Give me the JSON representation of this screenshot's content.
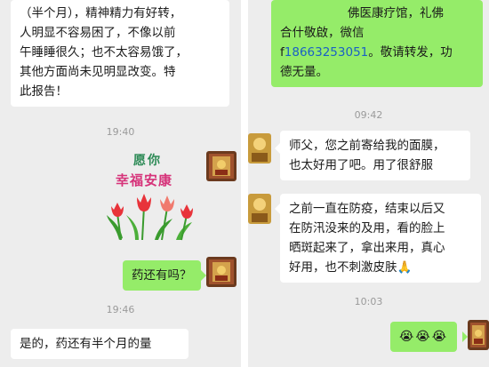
{
  "left": {
    "msg1_lines": [
      "（半个月），精神精力有好转，",
      "人明显不容易困了，不像以前",
      "午睡睡很久；也不太容易饿了，",
      "其他方面尚未见明显改变。特",
      "此报告！"
    ],
    "time1": "19:40",
    "sticker": {
      "line1": "愿你",
      "line2": "幸福安康",
      "colors": {
        "tulip_red": "#e8333a",
        "tulip_pink": "#f07a6e",
        "leaf_green": "#3a9b2e",
        "text_green": "#2e8b57",
        "text_pink": "#d6337a"
      }
    },
    "msg2": "药还有吗？",
    "time2": "19:46",
    "msg3": "是的，药还有半个月的量"
  },
  "right": {
    "msg1_lines": [
      "佛医康疗馆，礼佛",
      "合什敬啟，微信",
      "18663253051。敬请转发，功",
      "德无量。"
    ],
    "msg1_phone_prefix": "f",
    "msg1_phone": "18663253051",
    "msg1_phone_suffix": "。敬请转发，功",
    "time1": "09:42",
    "msg2_lines": [
      "师父，您之前寄给我的面膜，",
      "也太好用了吧。用了很舒服"
    ],
    "msg3_lines": [
      "之前一直在防疫，结束以后又",
      "在防汛没来的及用，看的脸上",
      "晒斑起来了，拿出来用，真心",
      "好用，也不刺激皮肤"
    ],
    "msg3_emoji": "🙏",
    "time2": "10:03",
    "msg4_emojis": [
      "😭",
      "😭",
      "😭"
    ]
  },
  "colors": {
    "bg": "#ededed",
    "bubble_green": "#95ec69",
    "bubble_white": "#ffffff",
    "timestamp": "#9a9a9a",
    "link": "#1a60c6"
  }
}
